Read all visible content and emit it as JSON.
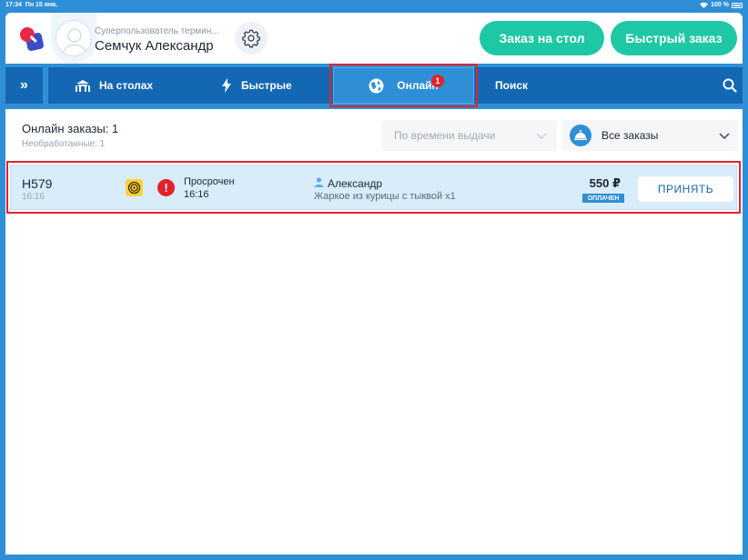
{
  "status_bar": {
    "time": "17:34",
    "date": "Пн 15 янв.",
    "battery": "100 %"
  },
  "header": {
    "user_role": "Суперпользователь термин...",
    "user_name": "Семчук Александр",
    "table_order_label": "Заказ на стол",
    "quick_order_label": "Быстрый заказ"
  },
  "tabs": {
    "expand_icon": "»",
    "tables_label": "На столах",
    "quick_label": "Быстрые",
    "online_label": "Онлайн",
    "online_badge": "1",
    "search_label": "Поиск"
  },
  "orders_panel": {
    "title": "Онлайн заказы: 1",
    "unprocessed": "Необработанные: 1",
    "sort_placeholder": "По времени выдачи",
    "filter_value": "Все заказы"
  },
  "orders": [
    {
      "id": "H579",
      "time": "16:16",
      "alert": "!",
      "status": "Просрочен",
      "status_time": "16:16",
      "customer": "Александр",
      "items": "Жаркое из курицы с тыквой x1",
      "price": "550 ₽",
      "payment_status": "ОПЛАЧЕН",
      "accept_label": "ПРИНЯТЬ"
    }
  ],
  "colors": {
    "primary": "#2f8fd6",
    "primary_dark": "#1467b3",
    "green": "#1ec8a5",
    "alert": "#e2232a",
    "row_highlight": "#d9ecf9"
  }
}
